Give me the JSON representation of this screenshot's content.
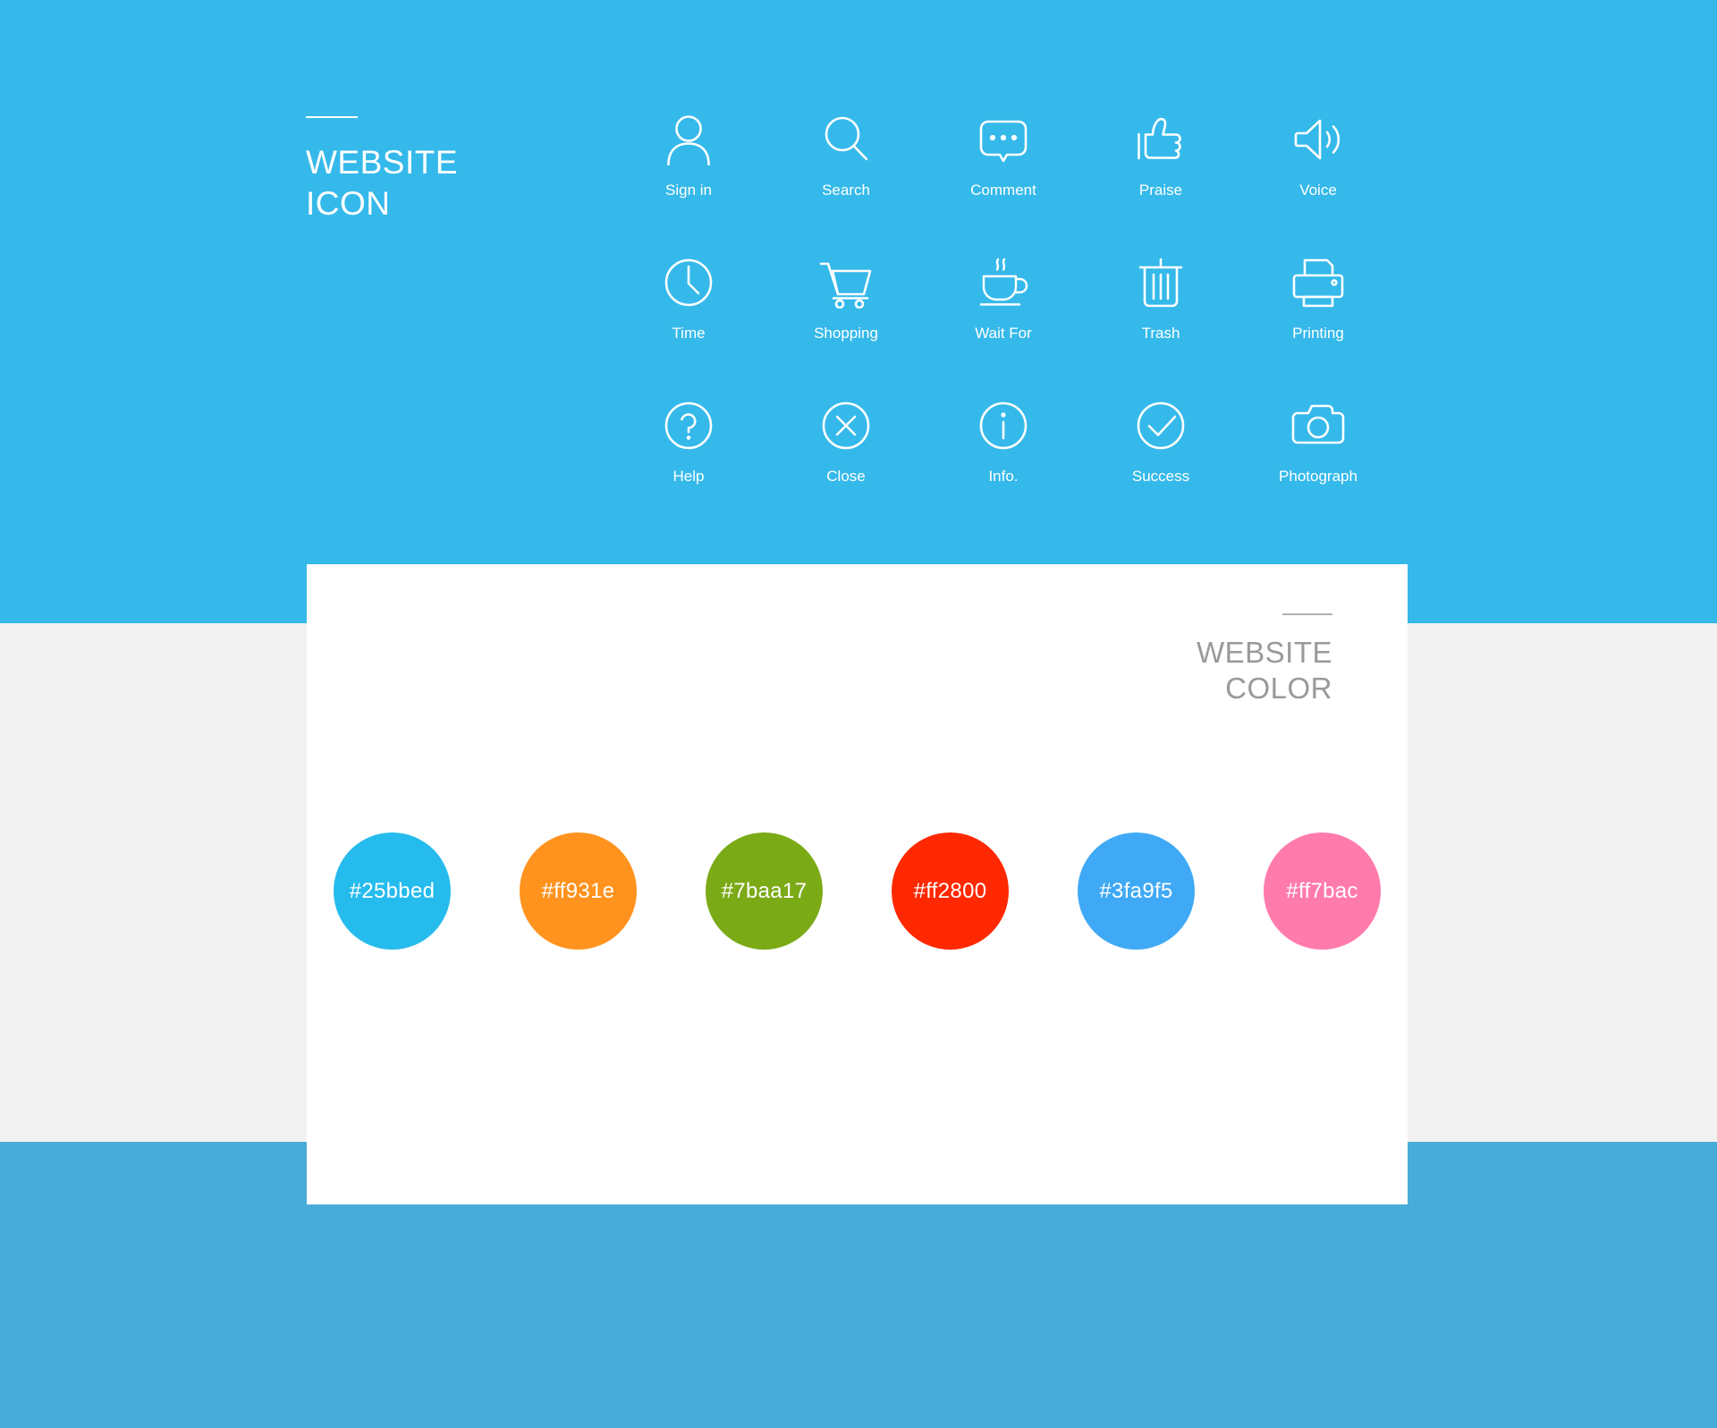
{
  "background": {
    "top_band_color": "#35b9ea",
    "middle_band_color": "#f2f2f2",
    "bottom_band_color": "#48acd8",
    "card_color": "#ffffff"
  },
  "icon_section": {
    "title_line1": "WEBSITE",
    "title_line2": "ICON",
    "title_color": "#ffffff",
    "icons": [
      {
        "icon": "user-icon",
        "label": "Sign in"
      },
      {
        "icon": "search-icon",
        "label": "Search"
      },
      {
        "icon": "comment-icon",
        "label": "Comment"
      },
      {
        "icon": "thumbs-up-icon",
        "label": "Praise"
      },
      {
        "icon": "volume-icon",
        "label": "Voice"
      },
      {
        "icon": "clock-icon",
        "label": "Time"
      },
      {
        "icon": "cart-icon",
        "label": "Shopping"
      },
      {
        "icon": "coffee-cup-icon",
        "label": "Wait For"
      },
      {
        "icon": "trash-icon",
        "label": "Trash"
      },
      {
        "icon": "printer-icon",
        "label": "Printing"
      },
      {
        "icon": "question-circle-icon",
        "label": "Help"
      },
      {
        "icon": "close-circle-icon",
        "label": "Close"
      },
      {
        "icon": "info-circle-icon",
        "label": "Info."
      },
      {
        "icon": "check-circle-icon",
        "label": "Success"
      },
      {
        "icon": "camera-icon",
        "label": "Photograph"
      }
    ]
  },
  "color_section": {
    "title_line1": "WEBSITE",
    "title_line2": "COLOR",
    "title_color": "#999999",
    "swatches": [
      {
        "hex": "#25bbed",
        "label": "#25bbed"
      },
      {
        "hex": "#ff931e",
        "label": "#ff931e"
      },
      {
        "hex": "#7baa17",
        "label": "#7baa17"
      },
      {
        "hex": "#ff2800",
        "label": "#ff2800"
      },
      {
        "hex": "#3fa9f5",
        "label": "#3fa9f5"
      },
      {
        "hex": "#ff7bac",
        "label": "#ff7bac"
      }
    ]
  }
}
